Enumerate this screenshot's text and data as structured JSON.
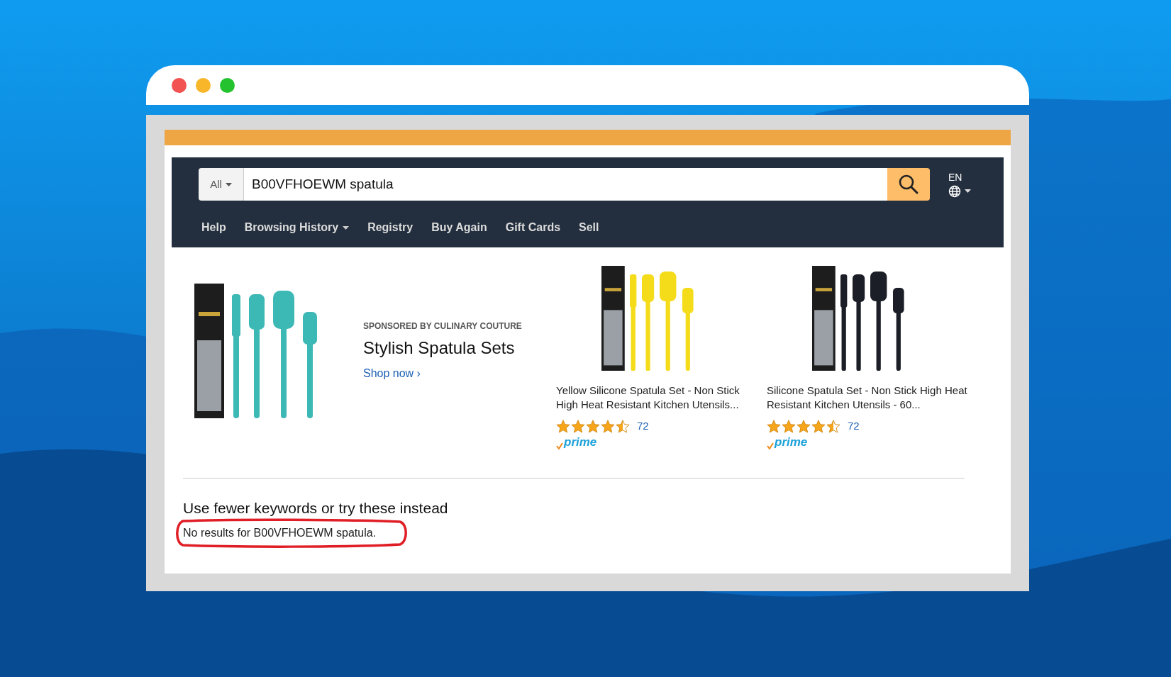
{
  "window": {
    "controls": [
      {
        "color": "#f25252"
      },
      {
        "color": "#f8b62a"
      },
      {
        "color": "#25c22f"
      }
    ]
  },
  "search": {
    "category": "All",
    "value": "B00VFHOEWM spatula",
    "language": "EN"
  },
  "nav": {
    "items": [
      {
        "label": "Help",
        "dropdown": false
      },
      {
        "label": "Browsing History",
        "dropdown": true
      },
      {
        "label": "Registry",
        "dropdown": false
      },
      {
        "label": "Buy Again",
        "dropdown": false
      },
      {
        "label": "Gift Cards",
        "dropdown": false
      },
      {
        "label": "Sell",
        "dropdown": false
      }
    ]
  },
  "sponsored": {
    "label": "SPONSORED BY CULINARY COUTURE",
    "title": "Stylish Spatula Sets",
    "link": "Shop now ›",
    "color": "#3cb8b5"
  },
  "products": [
    {
      "title": "Yellow Silicone Spatula Set - Non Stick High Heat Resistant Kitchen Utensils...",
      "stars": 4.5,
      "reviews": "72",
      "badge": "prime",
      "color": "#f5dc1a"
    },
    {
      "title": "Silicone Spatula Set - Non Stick High Heat Resistant Kitchen Utensils - 60...",
      "stars": 4.5,
      "reviews": "72",
      "badge": "prime",
      "color": "#1b1e26"
    }
  ],
  "results": {
    "heading": "Use fewer keywords or try these instead",
    "message": "No results for B00VFHOEWM spatula.",
    "highlighted": true
  }
}
